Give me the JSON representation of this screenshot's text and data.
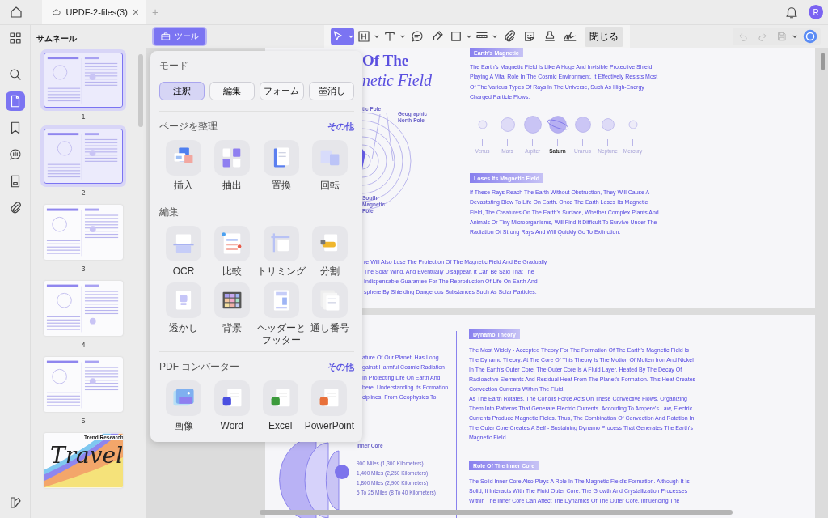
{
  "tab": {
    "title": "UPDF-2-files(3)",
    "close": "×",
    "new_tab": "+"
  },
  "avatar": "R",
  "rail": [
    {
      "selected": false
    },
    {
      "selected": false
    },
    {
      "selected": true
    },
    {
      "selected": false
    },
    {
      "selected": false
    },
    {
      "selected": false
    },
    {
      "selected": false
    },
    {
      "selected": false
    }
  ],
  "thumbnail_panel": {
    "title": "サムネール",
    "pages": [
      {
        "number": "1",
        "selected": true
      },
      {
        "number": "2",
        "selected": true
      },
      {
        "number": "3",
        "selected": false
      },
      {
        "number": "4",
        "selected": false
      },
      {
        "number": "5",
        "selected": false
      },
      {
        "selected": false,
        "subtitle": "Trend Research",
        "title": "Travel"
      }
    ]
  },
  "tools_button": {
    "label": "ツール",
    "selected": true
  },
  "toolbar": {
    "tools": [
      {
        "selected": true,
        "menu": true
      },
      {
        "selected": false,
        "menu": true
      },
      {
        "selected": false,
        "menu": true
      },
      {
        "selected": false,
        "menu": false
      },
      {
        "selected": false,
        "menu": false
      },
      {
        "selected": false,
        "menu": true
      },
      {
        "selected": false,
        "menu": true
      },
      {
        "selected": false,
        "menu": false
      },
      {
        "selected": false,
        "menu": false
      },
      {
        "selected": false,
        "menu": false
      },
      {
        "selected": false,
        "menu": false
      }
    ],
    "close": "閉じる"
  },
  "actions": [
    {
      "disabled": true,
      "menu": false
    },
    {
      "disabled": true,
      "menu": false
    },
    {
      "disabled": true,
      "menu": true
    },
    {
      "disabled": false,
      "menu": false
    }
  ],
  "tools_menu": {
    "mode_title": "モード",
    "modes": [
      {
        "label": "注釈",
        "selected": true
      },
      {
        "label": "編集",
        "selected": false
      },
      {
        "label": "フォーム",
        "selected": false
      },
      {
        "label": "墨消し",
        "selected": false
      }
    ],
    "sections": [
      {
        "title": "ページを整理",
        "more": "その他",
        "items": [
          "挿入",
          "抽出",
          "置換",
          "回転"
        ]
      },
      {
        "title": "編集",
        "items": [
          "OCR",
          "比較",
          "トリミング",
          "分割",
          "透かし",
          "背景",
          "ヘッダーとフッター",
          "通し番号"
        ]
      },
      {
        "title": "PDF コンバーター",
        "more": "その他",
        "items": [
          "画像",
          "Word",
          "Excel",
          "PowerPoint"
        ]
      }
    ]
  },
  "document": {
    "pages": [
      {
        "title": [
          "Of The",
          "netic Field"
        ],
        "pole_labels": [
          "tic Pole",
          "Geographic\nNorth Pole",
          "South\nMagnetic\nPole"
        ],
        "intro": {
          "heading": "Earth's Magnetic",
          "lines": [
            "The Earth's Magnetic Field Is Like A Huge And Invisible Protective Shield,",
            "Playing A Vital Role In The Cosmic Environment. It Effectively Resists Most",
            "Of The Various Types Of Rays In The Universe, Such As High-Energy",
            "Charged Particle Flows."
          ]
        },
        "planets": [
          {
            "name": "Venus",
            "selected": false
          },
          {
            "name": "Mars",
            "selected": false
          },
          {
            "name": "Jupiter",
            "selected": false
          },
          {
            "name": "Saturn",
            "selected": true
          },
          {
            "name": "Uranus",
            "selected": false
          },
          {
            "name": "Neptune",
            "selected": false
          },
          {
            "name": "Mercury",
            "selected": false
          }
        ],
        "loss": {
          "heading": "Loses Its Magnetic Field",
          "lines": [
            "If These Rays Reach The Earth Without Obstruction, They Will Cause A",
            "Devastating Blow To Life On Earth. Once The Earth Loses Its Magnetic",
            "Field, The Creatures On The Earth's Surface, Whether Complex Plants And",
            "Animals Or Tiny Microorganisms, Will Find It Difficult To Survive Under The",
            "Radiation Of Strong Rays And Will Quickly Go To Extinction."
          ]
        },
        "bottom_lines": [
          "re Will Also Lose The Protection Of The Magnetic Field And Be Gradually",
          "The Solar Wind, And Eventually Disappear. It Can Be Said That The",
          "Indispensable Guarantee For The Reproduction Of Life On Earth And",
          "sphere By Shielding Dangerous Substances Such As Solar Particles."
        ]
      },
      {
        "left_lines": [
          "ature Of Our Planet, Has Long",
          "gainst Harmful Cosmic Radiation",
          "In Protecting Life On Earth And",
          "here. Understanding Its Formation",
          "ciplines, From Geophysics To"
        ],
        "core_labels": [
          "Inner Core",
          "900 Miles (1,300 Kilometers)",
          "1,400 Miles (2,250 Kilometers)",
          "1,800 Miles (2,900 Kilometers)",
          "5 To 25 Miles (8 To 40 Kilometers)"
        ],
        "sections": [
          {
            "heading": "Dynamo Theory",
            "lines": [
              "The Most Widely - Accepted Theory For The Formation Of The Earth's Magnetic Field Is",
              "The Dynamo Theory. At The Core Of This Theory Is The Motion Of Molten Iron And Nickel",
              "In The Earth's Outer Core. The Outer Core Is A Fluid Layer, Heated By The Decay Of",
              "Radioactive Elements And Residual Heat From The Planet's Formation. This Heat Creates",
              "Convection Currents Within The Fluid.",
              "As The Earth Rotates, The Coriolis Force Acts On These Convective Flows, Organizing",
              "Them Into Patterns That Generate Electric Currents. According To Ampere's Law, Electric",
              "Currents Produce Magnetic Fields. Thus, The Combination Of Convection And Rotation In",
              "The Outer Core Creates A Self - Sustaining Dynamo Process That Generates The Earth's",
              "Magnetic Field."
            ]
          },
          {
            "heading": "Role Of The Inner Core",
            "lines": [
              "The Solid Inner Core Also Plays A Role In The Magnetic Field's Formation. Although It Is",
              "Solid, It Interacts With The Fluid Outer Core. The Growth And Crystallization Processes",
              "Within The Inner Core Can Affect The Dynamics Of The Outer Core, Influencing The"
            ]
          }
        ]
      }
    ]
  }
}
